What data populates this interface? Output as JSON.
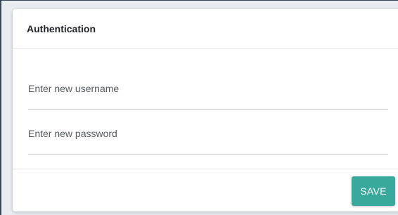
{
  "card": {
    "title": "Authentication"
  },
  "form": {
    "username": {
      "value": "",
      "placeholder": "Enter new username"
    },
    "password": {
      "value": "",
      "placeholder": "Enter new password"
    }
  },
  "footer": {
    "save_label": "SAVE"
  },
  "colors": {
    "accent": "#3aa99d",
    "frame": "#3b4654"
  }
}
